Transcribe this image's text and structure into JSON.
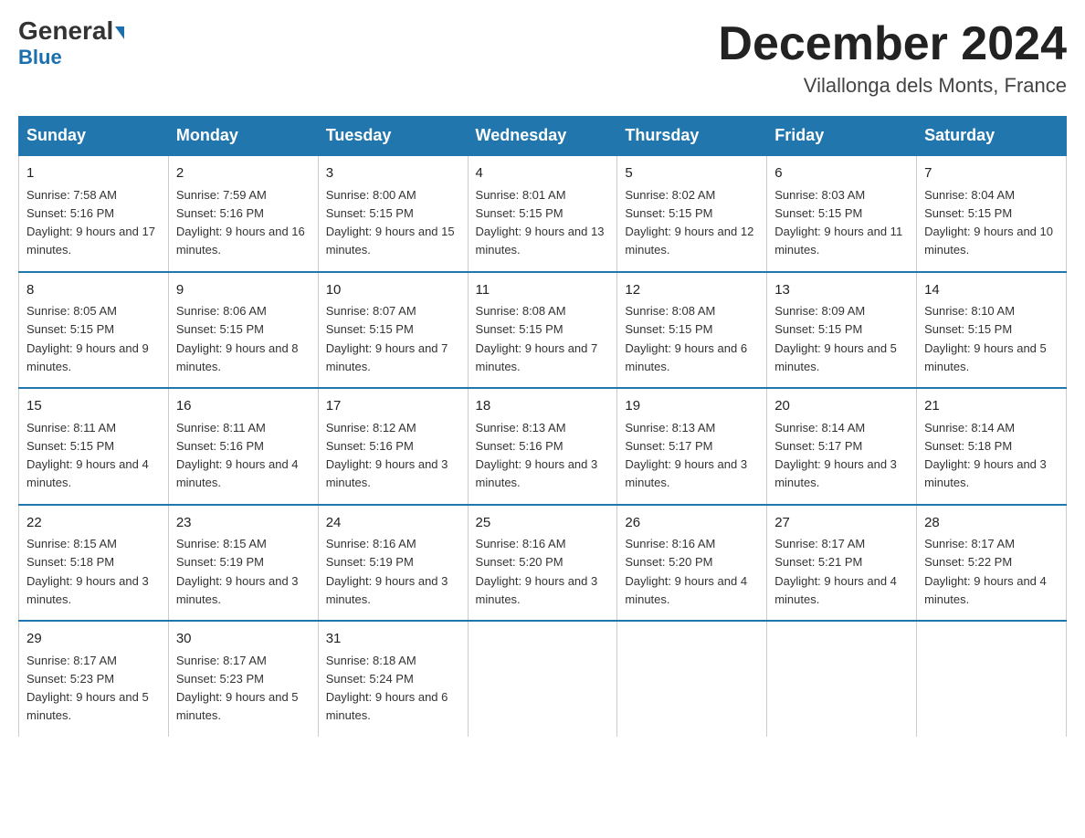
{
  "header": {
    "logo_general": "General",
    "logo_blue": "Blue",
    "month_title": "December 2024",
    "subtitle": "Vilallonga dels Monts, France"
  },
  "days_of_week": [
    "Sunday",
    "Monday",
    "Tuesday",
    "Wednesday",
    "Thursday",
    "Friday",
    "Saturday"
  ],
  "weeks": [
    [
      {
        "day": "1",
        "sunrise": "7:58 AM",
        "sunset": "5:16 PM",
        "daylight": "9 hours and 17 minutes."
      },
      {
        "day": "2",
        "sunrise": "7:59 AM",
        "sunset": "5:16 PM",
        "daylight": "9 hours and 16 minutes."
      },
      {
        "day": "3",
        "sunrise": "8:00 AM",
        "sunset": "5:15 PM",
        "daylight": "9 hours and 15 minutes."
      },
      {
        "day": "4",
        "sunrise": "8:01 AM",
        "sunset": "5:15 PM",
        "daylight": "9 hours and 13 minutes."
      },
      {
        "day": "5",
        "sunrise": "8:02 AM",
        "sunset": "5:15 PM",
        "daylight": "9 hours and 12 minutes."
      },
      {
        "day": "6",
        "sunrise": "8:03 AM",
        "sunset": "5:15 PM",
        "daylight": "9 hours and 11 minutes."
      },
      {
        "day": "7",
        "sunrise": "8:04 AM",
        "sunset": "5:15 PM",
        "daylight": "9 hours and 10 minutes."
      }
    ],
    [
      {
        "day": "8",
        "sunrise": "8:05 AM",
        "sunset": "5:15 PM",
        "daylight": "9 hours and 9 minutes."
      },
      {
        "day": "9",
        "sunrise": "8:06 AM",
        "sunset": "5:15 PM",
        "daylight": "9 hours and 8 minutes."
      },
      {
        "day": "10",
        "sunrise": "8:07 AM",
        "sunset": "5:15 PM",
        "daylight": "9 hours and 7 minutes."
      },
      {
        "day": "11",
        "sunrise": "8:08 AM",
        "sunset": "5:15 PM",
        "daylight": "9 hours and 7 minutes."
      },
      {
        "day": "12",
        "sunrise": "8:08 AM",
        "sunset": "5:15 PM",
        "daylight": "9 hours and 6 minutes."
      },
      {
        "day": "13",
        "sunrise": "8:09 AM",
        "sunset": "5:15 PM",
        "daylight": "9 hours and 5 minutes."
      },
      {
        "day": "14",
        "sunrise": "8:10 AM",
        "sunset": "5:15 PM",
        "daylight": "9 hours and 5 minutes."
      }
    ],
    [
      {
        "day": "15",
        "sunrise": "8:11 AM",
        "sunset": "5:15 PM",
        "daylight": "9 hours and 4 minutes."
      },
      {
        "day": "16",
        "sunrise": "8:11 AM",
        "sunset": "5:16 PM",
        "daylight": "9 hours and 4 minutes."
      },
      {
        "day": "17",
        "sunrise": "8:12 AM",
        "sunset": "5:16 PM",
        "daylight": "9 hours and 3 minutes."
      },
      {
        "day": "18",
        "sunrise": "8:13 AM",
        "sunset": "5:16 PM",
        "daylight": "9 hours and 3 minutes."
      },
      {
        "day": "19",
        "sunrise": "8:13 AM",
        "sunset": "5:17 PM",
        "daylight": "9 hours and 3 minutes."
      },
      {
        "day": "20",
        "sunrise": "8:14 AM",
        "sunset": "5:17 PM",
        "daylight": "9 hours and 3 minutes."
      },
      {
        "day": "21",
        "sunrise": "8:14 AM",
        "sunset": "5:18 PM",
        "daylight": "9 hours and 3 minutes."
      }
    ],
    [
      {
        "day": "22",
        "sunrise": "8:15 AM",
        "sunset": "5:18 PM",
        "daylight": "9 hours and 3 minutes."
      },
      {
        "day": "23",
        "sunrise": "8:15 AM",
        "sunset": "5:19 PM",
        "daylight": "9 hours and 3 minutes."
      },
      {
        "day": "24",
        "sunrise": "8:16 AM",
        "sunset": "5:19 PM",
        "daylight": "9 hours and 3 minutes."
      },
      {
        "day": "25",
        "sunrise": "8:16 AM",
        "sunset": "5:20 PM",
        "daylight": "9 hours and 3 minutes."
      },
      {
        "day": "26",
        "sunrise": "8:16 AM",
        "sunset": "5:20 PM",
        "daylight": "9 hours and 4 minutes."
      },
      {
        "day": "27",
        "sunrise": "8:17 AM",
        "sunset": "5:21 PM",
        "daylight": "9 hours and 4 minutes."
      },
      {
        "day": "28",
        "sunrise": "8:17 AM",
        "sunset": "5:22 PM",
        "daylight": "9 hours and 4 minutes."
      }
    ],
    [
      {
        "day": "29",
        "sunrise": "8:17 AM",
        "sunset": "5:23 PM",
        "daylight": "9 hours and 5 minutes."
      },
      {
        "day": "30",
        "sunrise": "8:17 AM",
        "sunset": "5:23 PM",
        "daylight": "9 hours and 5 minutes."
      },
      {
        "day": "31",
        "sunrise": "8:18 AM",
        "sunset": "5:24 PM",
        "daylight": "9 hours and 6 minutes."
      },
      null,
      null,
      null,
      null
    ]
  ]
}
